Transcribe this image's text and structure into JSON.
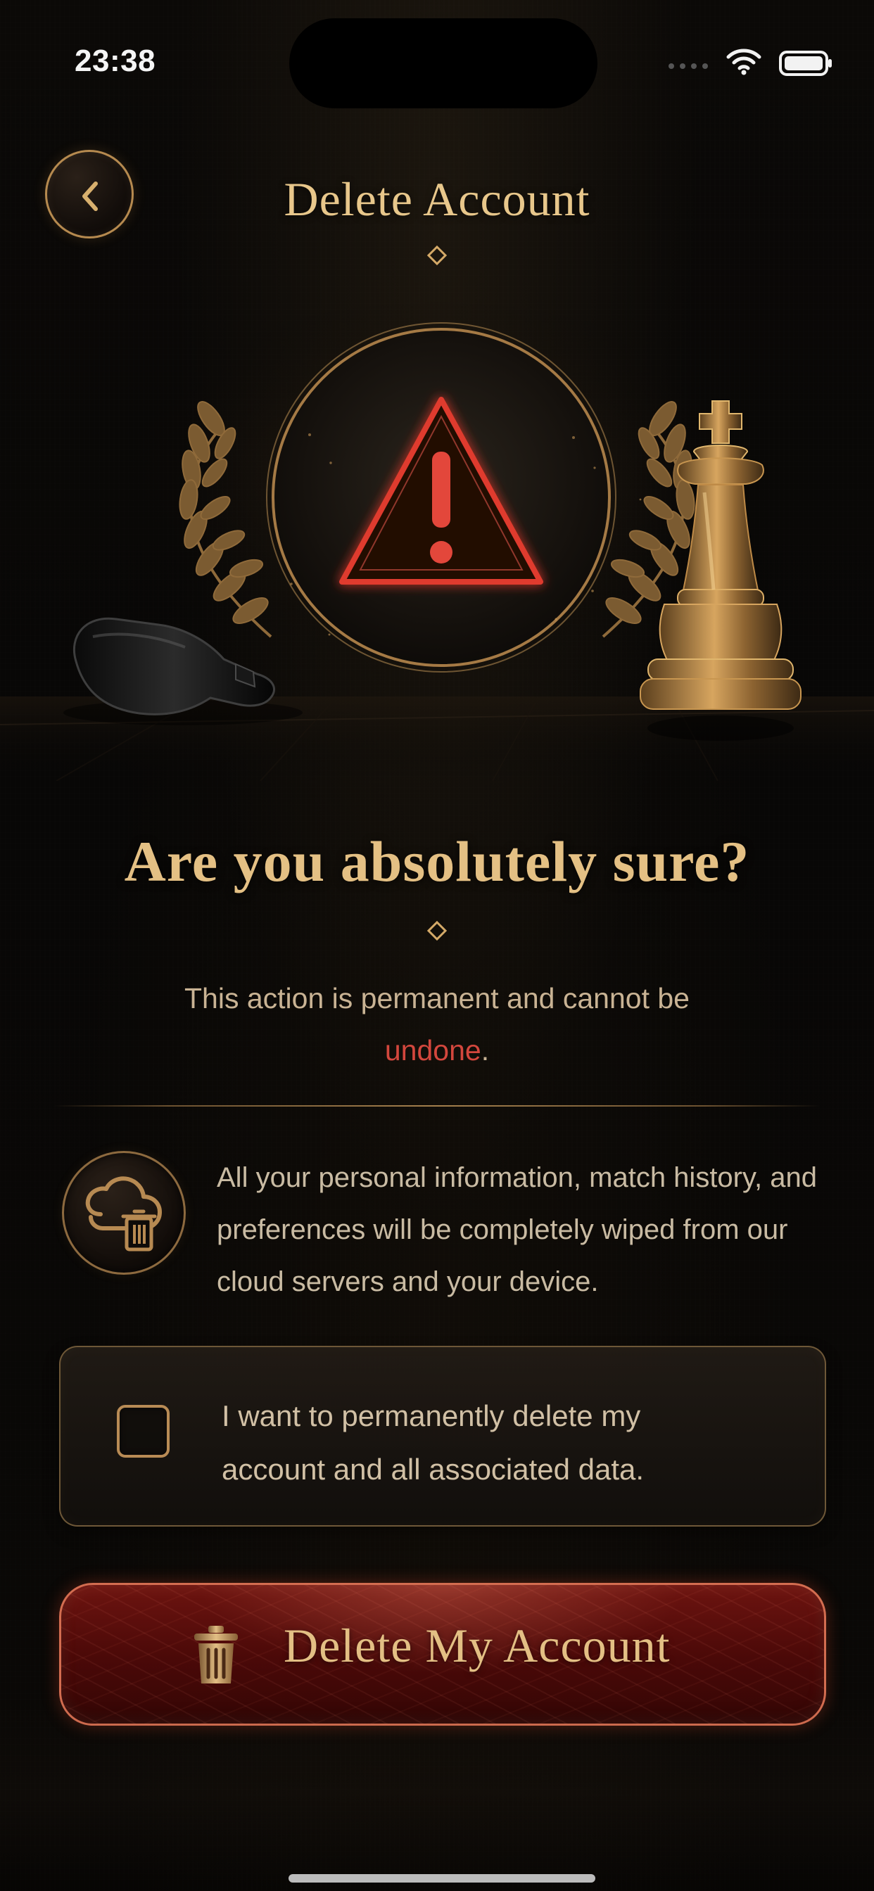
{
  "status_bar": {
    "time": "23:38"
  },
  "header": {
    "title": "Delete Account",
    "back_icon": "chevron-left-icon"
  },
  "hero": {
    "icon": "warning-triangle-icon",
    "decor": [
      "laurel-left",
      "laurel-right",
      "fallen-black-chess-piece",
      "gold-chess-king"
    ]
  },
  "confirmation": {
    "heading": "Are you absolutely sure?",
    "message_part1": "This action is permanent and cannot be",
    "message_highlight": "undone",
    "message_end": "."
  },
  "info": {
    "icon": "cloud-trash-icon",
    "text": "All your personal information, match history, and preferences will be completely wiped from our cloud servers and your device."
  },
  "consent": {
    "checked": false,
    "text": "I want to permanently delete my account and all associated data."
  },
  "delete_button": {
    "label": "Delete My Account",
    "icon": "trash-icon"
  },
  "colors": {
    "gold": "#e8c78b",
    "danger": "#d3473d",
    "background": "#090705"
  }
}
